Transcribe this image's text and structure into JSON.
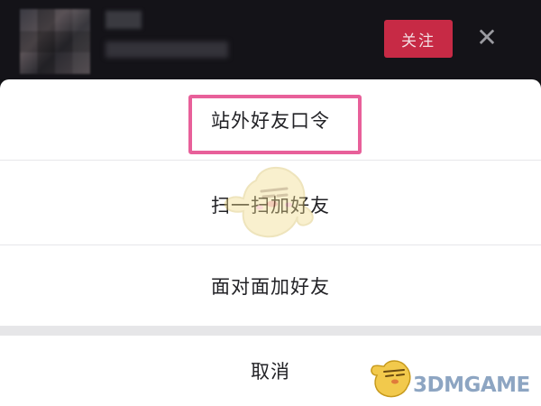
{
  "header": {
    "follow_label": "关注",
    "close_symbol": "✕"
  },
  "sheet": {
    "options": [
      {
        "label": "站外好友口令",
        "highlighted": true
      },
      {
        "label": "扫一扫加好友",
        "highlighted": false
      },
      {
        "label": "面对面加好友",
        "highlighted": false
      }
    ],
    "cancel_label": "取消"
  },
  "watermark": {
    "text": "3DMGAME"
  },
  "colors": {
    "header_bg": "#141318",
    "follow_button": "#c72a45",
    "highlight_border": "#e8609a",
    "sheet_bg": "#ffffff"
  }
}
